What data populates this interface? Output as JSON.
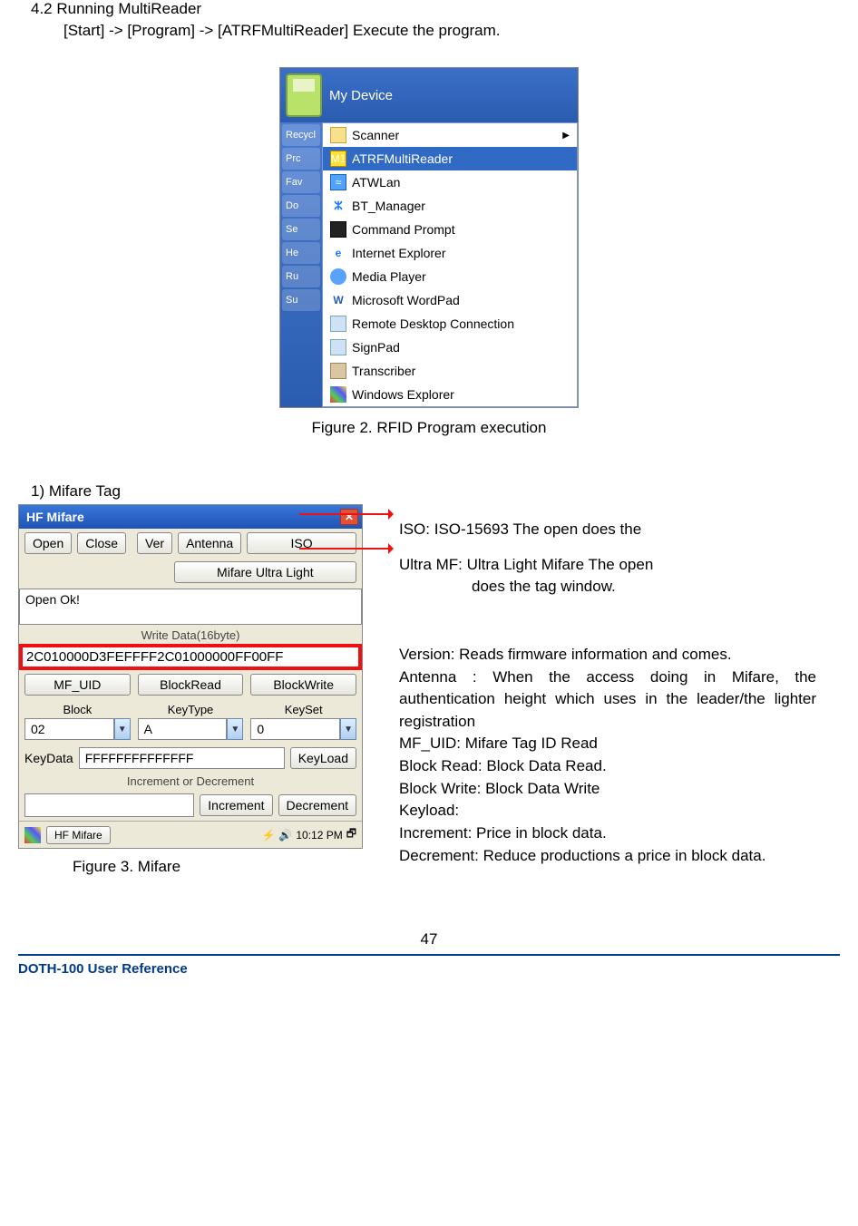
{
  "heading": "4.2 Running MultiReader",
  "start_line": "[Start] -> [Program] -> [ATRFMultiReader] Execute the program.",
  "startmenu": {
    "my_device": "My Device",
    "left_items": [
      "Recycl",
      "Prc",
      "Fav",
      "Do",
      "Se",
      "He",
      "Ru",
      "Su"
    ],
    "submenu": {
      "scanner": "Scanner",
      "atrf": "ATRFMultiReader",
      "atwlan": "ATWLan",
      "btmgr": "BT_Manager",
      "cmd": "Command Prompt",
      "ie": "Internet Explorer",
      "media": "Media Player",
      "wordpad": "Microsoft WordPad",
      "rdc": "Remote Desktop Connection",
      "signpad": "SignPad",
      "transcriber": "Transcriber",
      "winexp": "Windows Explorer"
    }
  },
  "fig2_caption": "Figure 2.   RFID Program execution",
  "mifare_heading": "1) Mifare Tag",
  "hfmifare": {
    "title": "HF Mifare",
    "buttons": {
      "open": "Open",
      "close": "Close",
      "ver": "Ver",
      "antenna": "Antenna",
      "iso": "ISO",
      "ultralight": "Mifare Ultra Light",
      "mfuid": "MF_UID",
      "blockread": "BlockRead",
      "blockwrite": "BlockWrite",
      "keyload": "KeyLoad",
      "increment": "Increment",
      "decrement": "Decrement"
    },
    "status": "Open Ok!",
    "writelabel": "Write Data(16byte)",
    "writedata": "2C010000D3FEFFFF2C01000000FF00FF",
    "row_labels": {
      "block": "Block",
      "keytype": "KeyType",
      "keyset": "KeySet",
      "keydata": "KeyData"
    },
    "block_val": "02",
    "keytype_val": "A",
    "keyset_val": "0",
    "keydata_val": "FFFFFFFFFFFFFF",
    "incdec_label": "Increment or Decrement",
    "incdec_val": "",
    "task_label": "HF Mifare",
    "clock": "10:12 PM"
  },
  "fig3_caption": "Figure 3.   Mifare",
  "desc": {
    "iso": "ISO: ISO-15693 The open does the",
    "ultra1": "Ultra MF: Ultra Light Mifare The open",
    "ultra2": "does the tag window.",
    "version": "Version: Reads firmware information and comes.",
    "antenna": "Antenna : When the access doing in Mifare, the authentication height which uses in the leader/the lighter registration",
    "mfuid": "MF_UID: Mifare Tag ID Read",
    "blockread": "Block Read: Block Data Read.",
    "blockwrite": "Block Write: Block Data Write",
    "keyload": "Keyload:",
    "increment": "Increment: Price in block data.",
    "decrement": "Decrement: Reduce productions a price in block data."
  },
  "page_num": "47",
  "footer": "DOTH-100 User Reference"
}
